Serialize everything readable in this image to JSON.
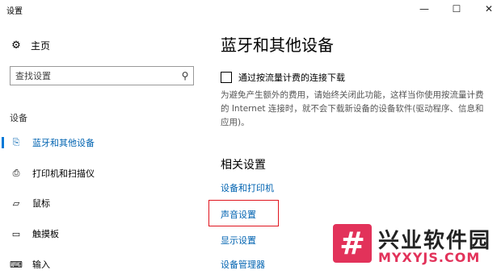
{
  "window": {
    "title": "设置",
    "controls": {
      "minimize": "—",
      "maximize": "☐",
      "close": "✕"
    }
  },
  "nav": {
    "home": {
      "icon": "gear-icon",
      "label": "主页"
    },
    "search": {
      "placeholder": "查找设置",
      "icon": "search-icon"
    },
    "section_label": "设备",
    "items": [
      {
        "icon": "bluetooth-devices-icon",
        "label": "蓝牙和其他设备",
        "active": true
      },
      {
        "icon": "printer-icon",
        "label": "打印机和扫描仪",
        "active": false
      },
      {
        "icon": "mouse-icon",
        "label": "鼠标",
        "active": false
      },
      {
        "icon": "touchpad-icon",
        "label": "触摸板",
        "active": false
      },
      {
        "icon": "keyboard-icon",
        "label": "输入",
        "active": false
      }
    ]
  },
  "main": {
    "title": "蓝牙和其他设备",
    "metered_checkbox": {
      "label": "通过按流量计费的连接下载",
      "checked": false
    },
    "description": "为避免产生额外的费用，请始终关闭此功能，这样当你使用按流量计费的 Internet 连接时，就不会下载新设备的设备软件(驱动程序、信息和应用)。",
    "related_heading": "相关设置",
    "links": [
      {
        "label": "设备和打印机"
      },
      {
        "label": "声音设置",
        "highlighted": true
      },
      {
        "label": "显示设置"
      },
      {
        "label": "设备管理器"
      }
    ]
  },
  "watermark": {
    "logo_glyph": "#",
    "cn": "兴业软件园",
    "en": "MYXYJS.COM"
  },
  "colors": {
    "accent": "#0063b1",
    "highlight_border": "#e0141e",
    "watermark": "#e2325a"
  }
}
